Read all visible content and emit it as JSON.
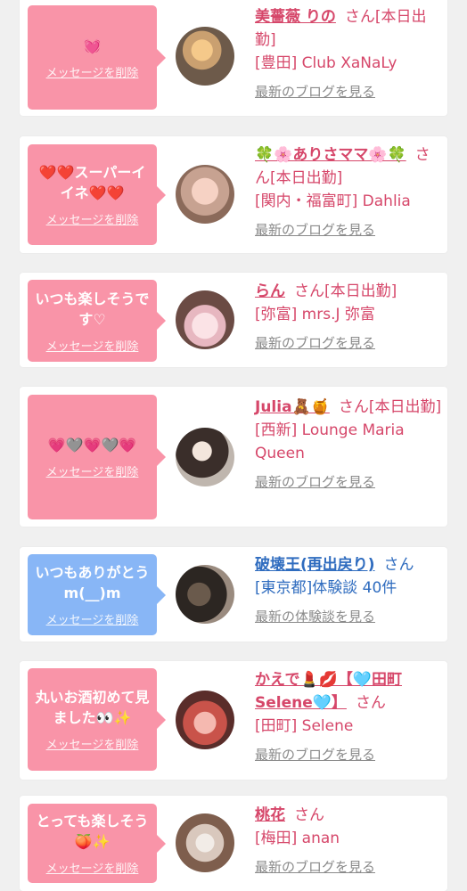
{
  "common": {
    "delete_label": "メッセージを削除",
    "san": "さん",
    "blog_link": "最新のブログを見る"
  },
  "items": [
    {
      "message": "💓",
      "name": "美薔薇 りの",
      "status": "[本日出勤]",
      "shop": "[豊田] Club XaNaLy",
      "link": "最新のブログを見る",
      "color": "pink"
    },
    {
      "message": "❤️❤️スーパーイイネ❤️❤️",
      "name": "🍀🌸ありさママ🌸🍀",
      "status": "[本日出勤]",
      "shop": "[関内・福富町] Dahlia",
      "link": "最新のブログを見る",
      "color": "pink"
    },
    {
      "message": "いつも楽しそうです♡",
      "name": "らん",
      "status": "[本日出勤]",
      "shop": "[弥富] mrs.J 弥富",
      "link": "最新のブログを見る",
      "color": "pink"
    },
    {
      "message": "💗🩶💗🩶💗",
      "name": "Julia🧸🍯",
      "status": "[本日出勤]",
      "shop": "[西新] Lounge Maria Queen",
      "link": "最新のブログを見る",
      "color": "pink"
    },
    {
      "message": "いつもありがとうm(__)m",
      "name": "破壊王(再出戻り)",
      "status": "",
      "shop": "[東京都]体験談 40件",
      "link": "最新の体験談を見る",
      "color": "blue"
    },
    {
      "message": "丸いお酒初めて見ました👀✨",
      "name": "かえで💄💋【🩵田町Selene🩵】",
      "status": "",
      "shop": "[田町] Selene",
      "link": "最新のブログを見る",
      "color": "pink"
    },
    {
      "message": "とっても楽しそう🍑✨",
      "name": "桃花",
      "status": "",
      "shop": "[梅田] anan",
      "link": "最新のブログを見る",
      "color": "pink"
    }
  ]
}
